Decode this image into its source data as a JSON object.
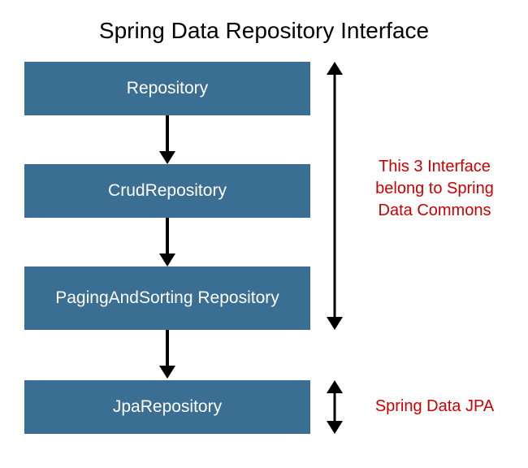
{
  "title": "Spring Data Repository Interface",
  "boxes": {
    "b1": "Repository",
    "b2": "CrudRepository",
    "b3": "PagingAndSorting Repository",
    "b4": "JpaRepository"
  },
  "annotations": {
    "top": "This 3 Interface belong to Spring Data Commons",
    "bottom": "Spring Data JPA"
  },
  "colors": {
    "box_bg": "#3A6E93",
    "box_text": "#FFFFFF",
    "annotation_text": "#CC0000",
    "arrow": "#000000"
  }
}
